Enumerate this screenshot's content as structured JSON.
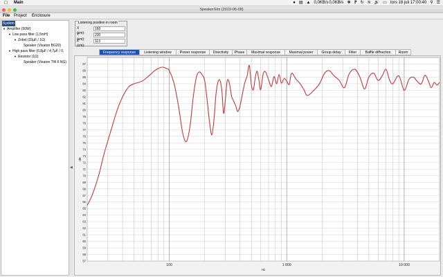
{
  "menubar": {
    "app_name": "Main",
    "time": "tors 18 juli  17:00:40",
    "net_up": "0,0KB/s",
    "net_down": "0,0KB/s"
  },
  "window": {
    "title": "SpeakerSim (2019-06-08)"
  },
  "app_menu": [
    "File",
    "Project",
    "Enclosure"
  ],
  "tree": [
    {
      "label": "System",
      "selected": true
    },
    {
      "label": "Amplifier (50W)",
      "arrow": true
    },
    {
      "label": "Low pass filter (1,5mH)",
      "arrow": true
    },
    {
      "label": "Zobel (33µF / 1Ω)",
      "arrow": true
    },
    {
      "label": "Speaker (Visaton BG20)"
    },
    {
      "label": "High pass filter (6,8µF / 4,7µF / 0,",
      "arrow": true
    },
    {
      "label": "Resistor (1Ω)",
      "arrow": true
    },
    {
      "label": "Speaker (Visaton TW 6 NG)"
    }
  ],
  "listening": {
    "title": "Listening position in room",
    "x_label": "X (cm):",
    "x_value": "160",
    "y_label": "Y (cm):",
    "y_value": "230",
    "z_label": "Z (cm):",
    "z_value": "113"
  },
  "tabs": [
    "Frequency response",
    "Listening window",
    "Power response",
    "Directivity",
    "Phase",
    "Maximal response",
    "Maximal power",
    "Group delay",
    "Filter",
    "Baffle diffraction",
    "Room"
  ],
  "active_tab": 0,
  "chart_data": {
    "type": "line",
    "xlabel": "Hz",
    "ylabel": "dB",
    "xscale": "log",
    "xlim": [
      20,
      20000
    ],
    "ylim": [
      57,
      88
    ],
    "x_ticks": [
      100,
      1000,
      10000
    ],
    "x_tick_labels": [
      "100",
      "1 000",
      "10 000"
    ],
    "y_ticks": [
      57,
      58,
      59,
      60,
      61,
      62,
      63,
      64,
      65,
      66,
      67,
      68,
      69,
      70,
      71,
      72,
      73,
      74,
      75,
      76,
      77,
      78,
      79,
      80,
      81,
      82,
      83,
      84,
      85,
      86,
      87
    ],
    "line_color": "#c0393b",
    "grid": true,
    "series": [
      {
        "x": [
          20,
          22,
          25,
          28,
          32,
          36,
          40,
          45,
          50,
          55,
          60,
          65,
          70,
          75,
          80,
          85,
          90,
          95,
          100,
          110,
          120,
          130,
          140,
          150,
          160,
          170,
          180,
          190,
          200,
          210,
          220,
          230,
          240,
          250,
          260,
          270,
          280,
          290,
          300,
          310,
          320,
          330,
          340,
          350,
          360,
          370,
          380,
          390,
          400,
          420,
          440,
          460,
          480,
          500,
          520,
          540,
          560,
          580,
          600,
          630,
          660,
          700,
          740,
          780,
          820,
          860,
          900,
          950,
          1000,
          1050,
          1100,
          1200,
          1300,
          1400,
          1500,
          1700,
          1900,
          2100,
          2300,
          2500,
          2800,
          3100,
          3400,
          3800,
          4200,
          4600,
          5000,
          5500,
          6000,
          6500,
          7000,
          7500,
          8000,
          9000,
          10000,
          11000,
          12000,
          13000,
          14000,
          15000,
          16000,
          17000,
          18000,
          19000,
          20000
        ],
        "y": [
          65.5,
          67,
          70,
          73.5,
          77,
          80,
          82,
          83.5,
          84,
          84.2,
          84.5,
          85,
          85.5,
          86,
          86.3,
          86.5,
          86.5,
          86.3,
          86,
          84,
          80.5,
          76.5,
          75.2,
          77.5,
          82,
          85,
          85.8,
          85.4,
          84.5,
          81.5,
          78.2,
          76.2,
          78.5,
          82.5,
          84.3,
          84.5,
          83,
          79.5,
          81.5,
          84.3,
          84.5,
          83.4,
          82,
          81.5,
          81,
          80.5,
          79.8,
          80,
          80.6,
          82.5,
          84.2,
          85.2,
          86.8,
          83.8,
          83.1,
          85,
          85.9,
          84.5,
          83.1,
          85.5,
          85.8,
          84.6,
          83.6,
          85.1,
          84,
          85.4,
          84.1,
          84.8,
          84.4,
          83.9,
          85.6,
          84.7,
          84,
          83.1,
          82.2,
          83,
          84,
          85.6,
          86,
          85.3,
          84.5,
          83.4,
          85.5,
          86.2,
          85,
          83.2,
          85,
          85.6,
          84.5,
          85.2,
          86.2,
          84.6,
          84,
          85.2,
          83,
          84.7,
          85,
          84.3,
          84,
          85.3,
          84.5,
          83.4,
          84.2,
          83.8,
          84.2
        ]
      }
    ]
  }
}
